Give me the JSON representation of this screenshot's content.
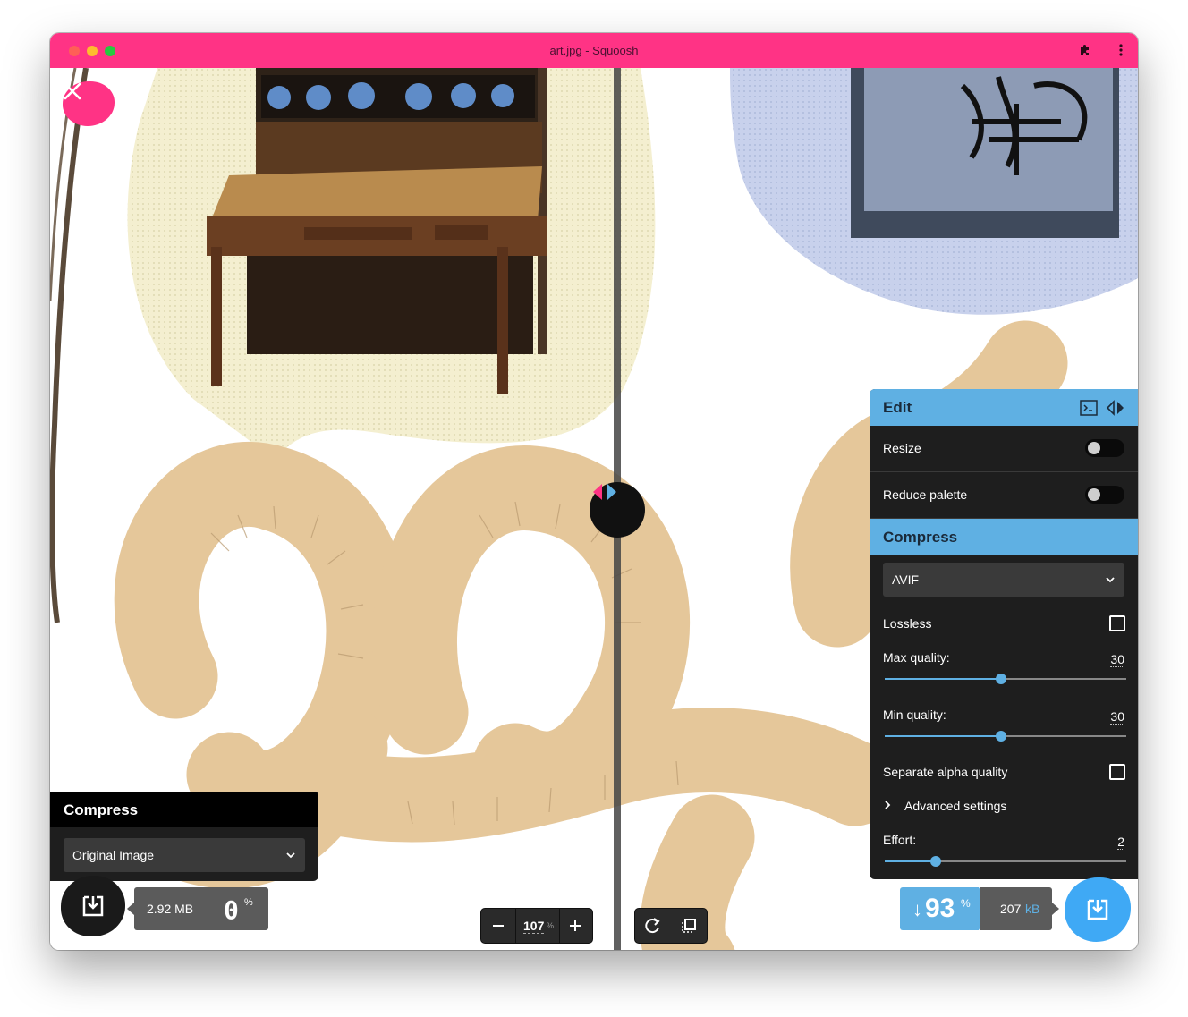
{
  "window": {
    "title": "art.jpg - Squoosh"
  },
  "colors": {
    "titlebar": "#ff3385",
    "accent_blue": "#5fb0e3",
    "panel_bg": "#1e1e1e"
  },
  "icons": {
    "titlebar": [
      "puzzle-icon",
      "more-vert-icon"
    ],
    "canvas": [
      "close-icon",
      "compare-arrows-icon"
    ],
    "footer": [
      "download-icon",
      "zoom-out-icon",
      "zoom-in-icon",
      "rotate-icon",
      "background-toggle-icon"
    ],
    "edit_panel": [
      "terminal-icon",
      "expand-arrows-icon",
      "chevron-right-icon",
      "chevron-down-icon"
    ]
  },
  "left_panel": {
    "title": "Compress",
    "method": "Original Image",
    "size": "2.92 MB",
    "percent": "0",
    "percent_unit": "%"
  },
  "zoom": {
    "value": "107",
    "unit": "%"
  },
  "right_panel": {
    "edit_title": "Edit",
    "resize_label": "Resize",
    "resize_enabled": false,
    "reduce_palette_label": "Reduce palette",
    "reduce_palette_enabled": false,
    "compress_title": "Compress",
    "codec": "AVIF",
    "lossless_label": "Lossless",
    "lossless_checked": false,
    "max_quality_label": "Max quality:",
    "max_quality": "30",
    "max_quality_fraction": 0.48,
    "min_quality_label": "Min quality:",
    "min_quality": "30",
    "min_quality_fraction": 0.48,
    "separate_alpha_label": "Separate alpha quality",
    "separate_alpha_checked": false,
    "advanced_label": "Advanced settings",
    "effort_label": "Effort:",
    "effort": "2",
    "effort_fraction": 0.21
  },
  "right_footer": {
    "arrow": "↓",
    "percent": "93",
    "percent_unit": "%",
    "size": "207",
    "size_unit": "kB"
  }
}
